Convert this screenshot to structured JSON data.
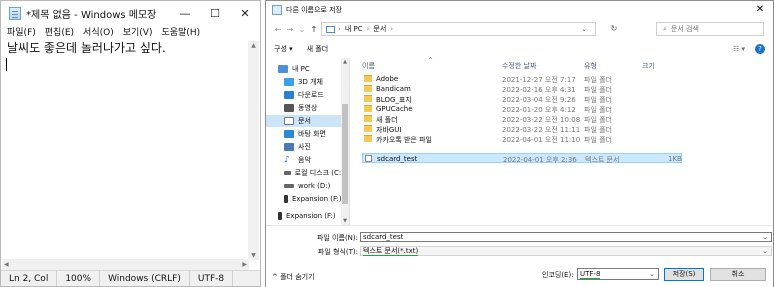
{
  "notepad": {
    "title": "*제목 없음 - Windows 메모장",
    "controls": {
      "minimize": "—",
      "maximize": "☐",
      "close": "✕"
    },
    "menu": [
      "파일(F)",
      "편집(E)",
      "서식(O)",
      "보기(V)",
      "도움말(H)"
    ],
    "content": "날씨도 좋은데 놀러나가고 싶다.",
    "status": {
      "position": "Ln 2, Col",
      "zoom": "100%",
      "line_ending": "Windows (CRLF)",
      "encoding": "UTF-8"
    }
  },
  "dialog": {
    "title": "다른 이름으로 저장",
    "close": "✕",
    "nav": {
      "back": "←",
      "forward": "→",
      "up_menu": "⌄",
      "up": "↑"
    },
    "breadcrumb": [
      "내 PC",
      "›",
      "문서",
      "›"
    ],
    "refresh": "↻",
    "search_placeholder": "문서 검색",
    "toolbar": {
      "organize": "구성 ▾",
      "new_folder": "새 폴더",
      "view": "☷ ▾",
      "help": "?"
    },
    "nav_items": [
      {
        "label": "내 PC",
        "icon": "pc-icon",
        "color": "#4d8fd4"
      },
      {
        "label": "3D 개체",
        "icon": "cube-icon",
        "color": "#3aa0e8"
      },
      {
        "label": "다운로드",
        "icon": "download-icon",
        "color": "#2a7fd4"
      },
      {
        "label": "동영상",
        "icon": "video-icon",
        "color": "#555555"
      },
      {
        "label": "문서",
        "icon": "document-icon",
        "color": "#777777"
      },
      {
        "label": "바탕 화면",
        "icon": "desktop-icon",
        "color": "#2a8ad8"
      },
      {
        "label": "사진",
        "icon": "picture-icon",
        "color": "#4a78b0"
      },
      {
        "label": "음악",
        "icon": "music-icon",
        "color": "#2a7fd4"
      },
      {
        "label": "로컬 디스크 (C:)",
        "icon": "drive-icon",
        "color": "#666666"
      },
      {
        "label": "work (D:)",
        "icon": "drive-icon",
        "color": "#666666"
      },
      {
        "label": "Expansion (F:)",
        "icon": "usb-drive-icon",
        "color": "#333333"
      },
      {
        "label": "Expansion (F:)",
        "icon": "usb-drive-icon",
        "color": "#333333"
      }
    ],
    "columns": {
      "name": "이름",
      "date": "수정한 날짜",
      "type": "유형",
      "size": "크기"
    },
    "files": [
      {
        "name": "Adobe",
        "date": "2021-12-27 오전 7:17",
        "type": "파일 폴더",
        "size": "",
        "icon": "folder-icon"
      },
      {
        "name": "Bandicam",
        "date": "2022-02-16 오후 4:31",
        "type": "파일 폴더",
        "size": "",
        "icon": "folder-icon"
      },
      {
        "name": "BLOG_표지",
        "date": "2022-03-04 오전 9:26",
        "type": "파일 폴더",
        "size": "",
        "icon": "folder-icon"
      },
      {
        "name": "GPUCache",
        "date": "2022-01-20 오후 4:12",
        "type": "파일 폴더",
        "size": "",
        "icon": "folder-icon"
      },
      {
        "name": "새 폴더",
        "date": "2022-03-22 오전 10:08",
        "type": "파일 폴더",
        "size": "",
        "icon": "folder-icon"
      },
      {
        "name": "자바GUI",
        "date": "2022-03-22 오전 11:11",
        "type": "파일 폴더",
        "size": "",
        "icon": "folder-icon"
      },
      {
        "name": "카카오톡 받은 파일",
        "date": "2022-04-01 오전 11:10",
        "type": "파일 폴더",
        "size": "",
        "icon": "folder-icon"
      },
      {
        "name": "sdcard_test",
        "date": "2022-04-01 오후 2:36",
        "type": "텍스트 문서",
        "size": "1KB",
        "icon": "text-file-icon"
      }
    ],
    "form": {
      "filename_label": "파일 이름(N):",
      "filename_value": "sdcard_test",
      "filetype_label": "파일 형식(T):",
      "filetype_value": "텍스트 문서(*.txt)"
    },
    "footer": {
      "hide_folders": "^ 폴더 숨기기",
      "encoding_label": "인코딩(E):",
      "encoding_value": "UTF-8",
      "save": "저장(S)",
      "cancel": "취소"
    }
  }
}
